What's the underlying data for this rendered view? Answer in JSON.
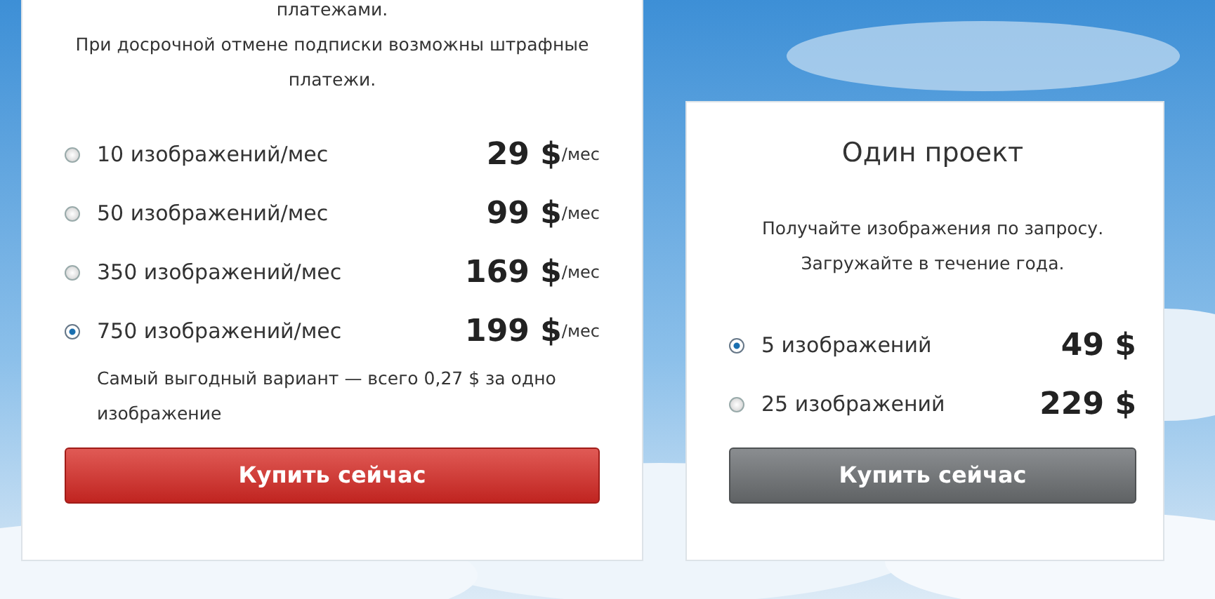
{
  "subscription": {
    "description": [
      "платежами.",
      "При досрочной отмене подписки возможны штрафные платежи."
    ],
    "options": [
      {
        "label": "10 изображений/мес",
        "price": "29 $",
        "per": "/мес",
        "selected": false
      },
      {
        "label": "50 изображений/мес",
        "price": "99 $",
        "per": "/мес",
        "selected": false
      },
      {
        "label": "350 изображений/мес",
        "price": "169 $",
        "per": "/мес",
        "selected": false
      },
      {
        "label": "750 изображений/мес",
        "price": "199 $",
        "per": "/мес",
        "selected": true,
        "note": "Самый выгодный вариант — всего 0,27 $ за одно изображение"
      }
    ],
    "button": {
      "label": "Купить сейчас",
      "kind": "primary"
    }
  },
  "single_project": {
    "title": "Один проект",
    "description": [
      "Получайте изображения по запросу.",
      "Загружайте в течение года."
    ],
    "options": [
      {
        "label": "5 изображений",
        "price": "49 $",
        "selected": true
      },
      {
        "label": "25 изображений",
        "price": "229 $",
        "selected": false
      }
    ],
    "button": {
      "label": "Купить сейчас",
      "kind": "secondary"
    }
  }
}
